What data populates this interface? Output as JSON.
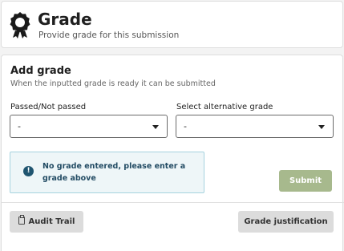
{
  "header": {
    "icon": "award-ribbon-icon",
    "title": "Grade",
    "subtitle": "Provide grade for this submission"
  },
  "add_grade": {
    "title": "Add grade",
    "description": "When the inputted grade is ready it can be submitted",
    "passed_select": {
      "label": "Passed/Not passed",
      "value": "-"
    },
    "alternative_select": {
      "label": "Select alternative grade",
      "value": "-"
    },
    "alert": {
      "icon": "exclamation-circle-icon",
      "message": "No grade entered, please enter a grade above"
    },
    "submit_label": "Submit"
  },
  "footer": {
    "audit_trail_label": "Audit Trail",
    "audit_icon": "clipboard-icon",
    "grade_justification_label": "Grade justification"
  },
  "colors": {
    "submit_disabled": "#a7b98d",
    "alert_bg": "#eef6f8",
    "alert_border": "#a6d3df",
    "alert_icon": "#1f5570"
  }
}
